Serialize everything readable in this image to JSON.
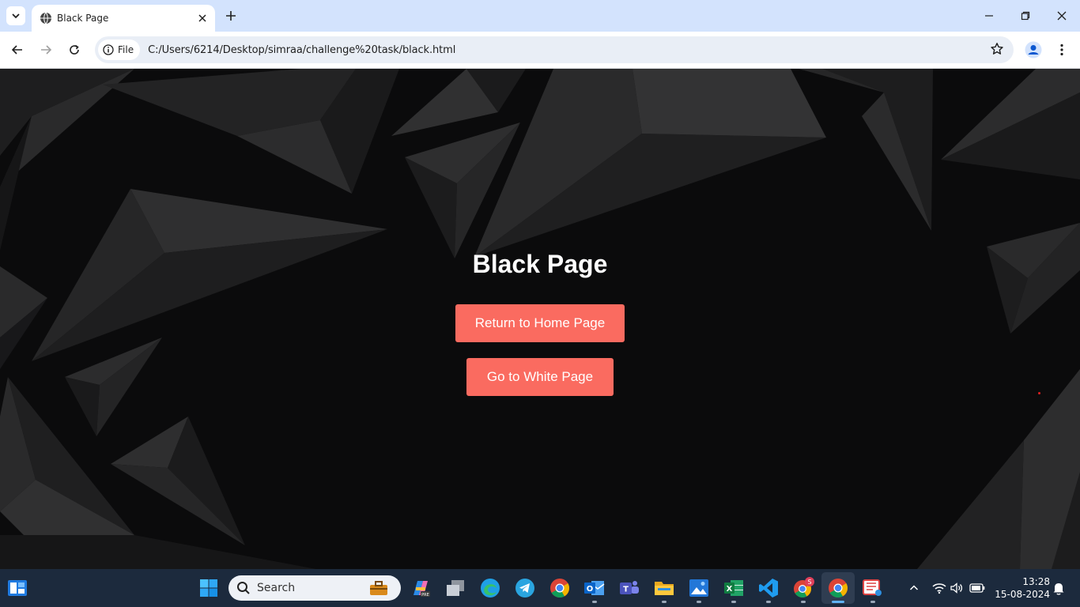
{
  "browser": {
    "tab_title": "Black Page",
    "chip_label": "File",
    "url": "C:/Users/6214/Desktop/simraa/challenge%20task/black.html"
  },
  "page": {
    "title": "Black Page",
    "home_button": "Return to Home Page",
    "white_button": "Go to White Page",
    "button_color": "#fa6b60",
    "background_color": "#0b0b0c"
  },
  "taskbar": {
    "search_placeholder": "Search",
    "time": "13:28",
    "date": "15-08-2024",
    "badge_letter": "S"
  }
}
